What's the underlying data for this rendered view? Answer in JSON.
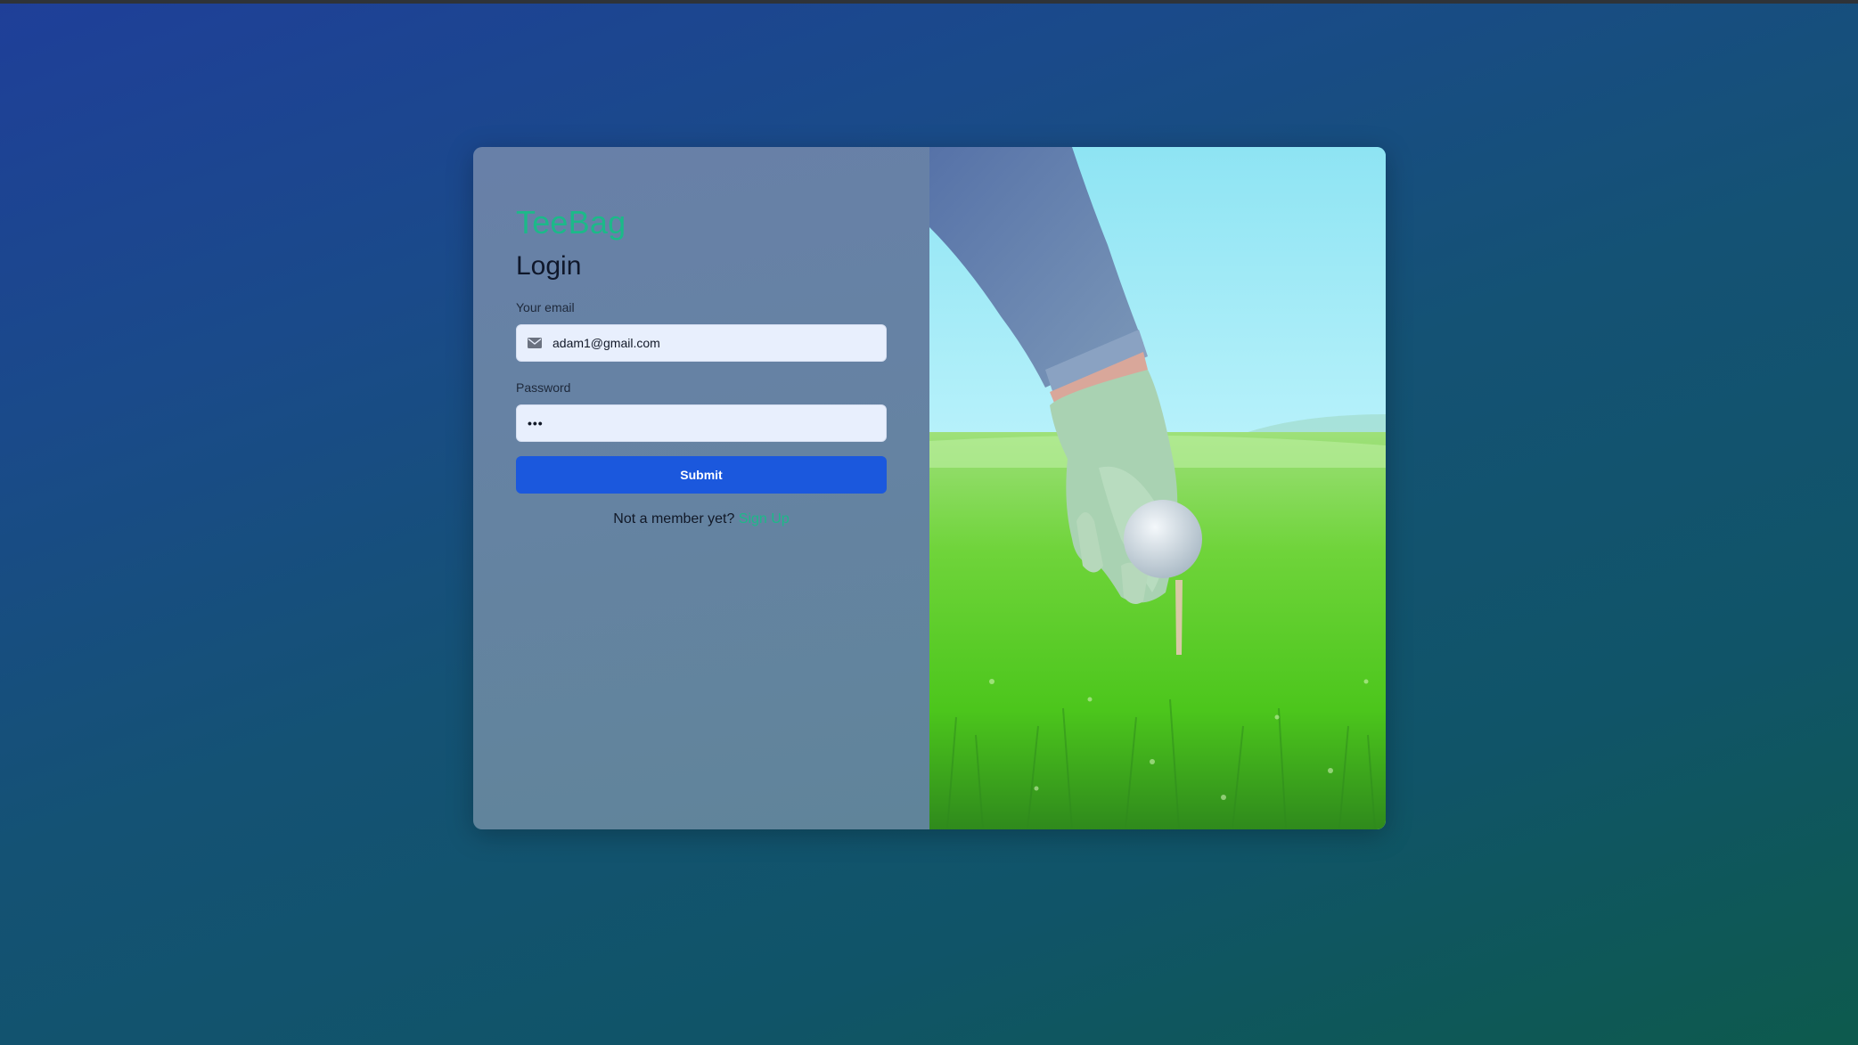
{
  "brand": "TeeBag",
  "heading": "Login",
  "email": {
    "label": "Your email",
    "value": "adam1@gmail.com",
    "icon": "mail-icon"
  },
  "password": {
    "label": "Password",
    "masked_value": "•••"
  },
  "submit_label": "Submit",
  "signup": {
    "prompt": "Not a member yet?",
    "link_label": "Sign Up"
  },
  "colors": {
    "brand": "#1cb989",
    "primary_button": "#1b58dd",
    "input_bg": "#e8effd"
  },
  "hero_image": {
    "icon": "golf-ball-on-tee-photo"
  }
}
